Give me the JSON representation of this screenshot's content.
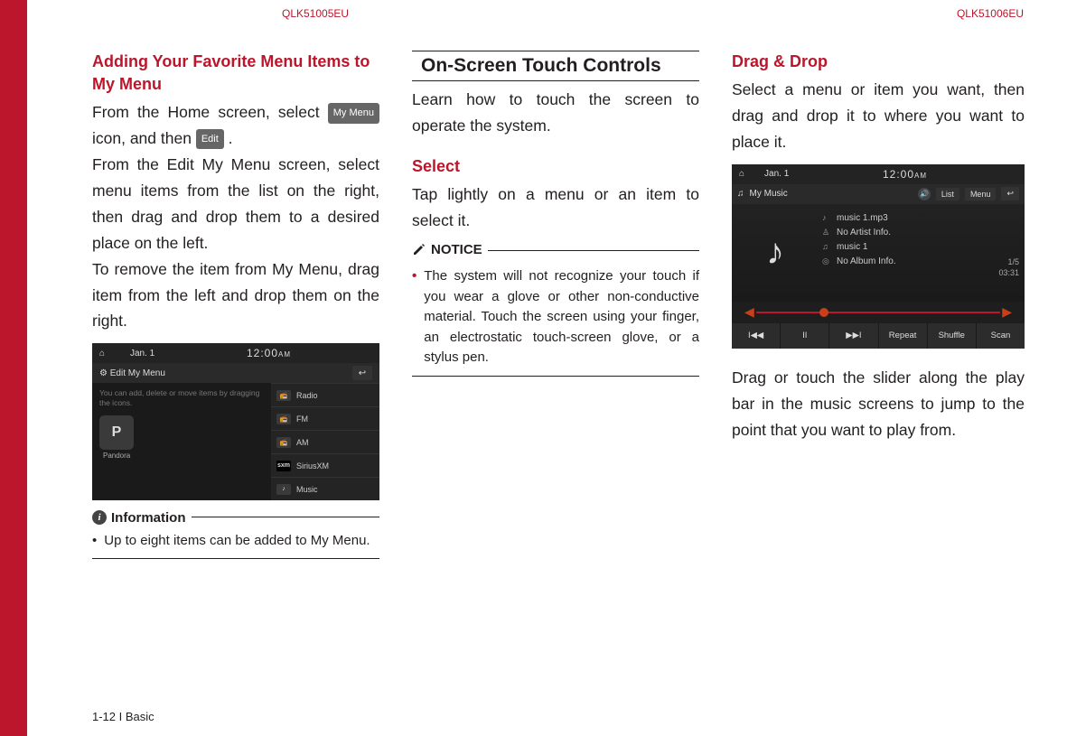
{
  "page_codes": {
    "left": "QLK51005EU",
    "right": "QLK51006EU"
  },
  "footer": "1-12 I Basic",
  "col1": {
    "heading": "Adding Your Favorite Menu Items to My Menu",
    "para1a": "From the Home screen, select ",
    "btn1": "My Menu",
    "para1b": " icon, and then ",
    "btn2": "Edit",
    "para1c": " .",
    "para2": "From the Edit My Menu screen, select menu items from the list on the right, then drag and drop them to a desired place on the left.",
    "para3": "To remove the item from My Menu, drag item from the left and drop them on the right.",
    "info_label": "Information",
    "info_bullet": "Up to eight items can be added to My Menu."
  },
  "shot1": {
    "date": "Jan. 1",
    "time": "12:00",
    "ampm": "AM",
    "title": "Edit My Menu",
    "hint": "You can add, delete or move items by dragging the icons.",
    "tile": "P",
    "tile_label": "Pandora",
    "list": [
      "Radio",
      "FM",
      "AM",
      "SiriusXM",
      "Music"
    ],
    "sxm": "sxm"
  },
  "col2": {
    "section_title": "On-Screen Touch Controls",
    "para1": "Learn how to touch the screen to operate the system.",
    "sub_heading": "Select",
    "sub_para": "Tap lightly on a menu or an item to select it.",
    "notice_label": "NOTICE",
    "notice_bullet": "The system will not recognize your touch if you wear a glove or other non-conductive material. Touch the screen using your finger, an electrostatic touch-screen glove, or a stylus pen."
  },
  "col3": {
    "heading": "Drag & Drop",
    "para1": "Select a menu or item you want, then drag and drop it to where you want to place it.",
    "para2": "Drag or touch the slider along the play bar in the music screens to jump to the point that you want to play from."
  },
  "shot2": {
    "date": "Jan. 1",
    "time": "12:00",
    "ampm": "AM",
    "source": "My Music",
    "btn_list": "List",
    "btn_menu": "Menu",
    "meta": {
      "file": "music 1.mp3",
      "artist": "No Artist Info.",
      "title": "music 1",
      "album": "No Album Info."
    },
    "track_count": "1/5",
    "elapsed": "03:31",
    "controls": {
      "prev": "I◀◀",
      "pause": "II",
      "next": "▶▶I",
      "repeat": "Repeat",
      "shuffle": "Shuffle",
      "scan": "Scan"
    }
  }
}
